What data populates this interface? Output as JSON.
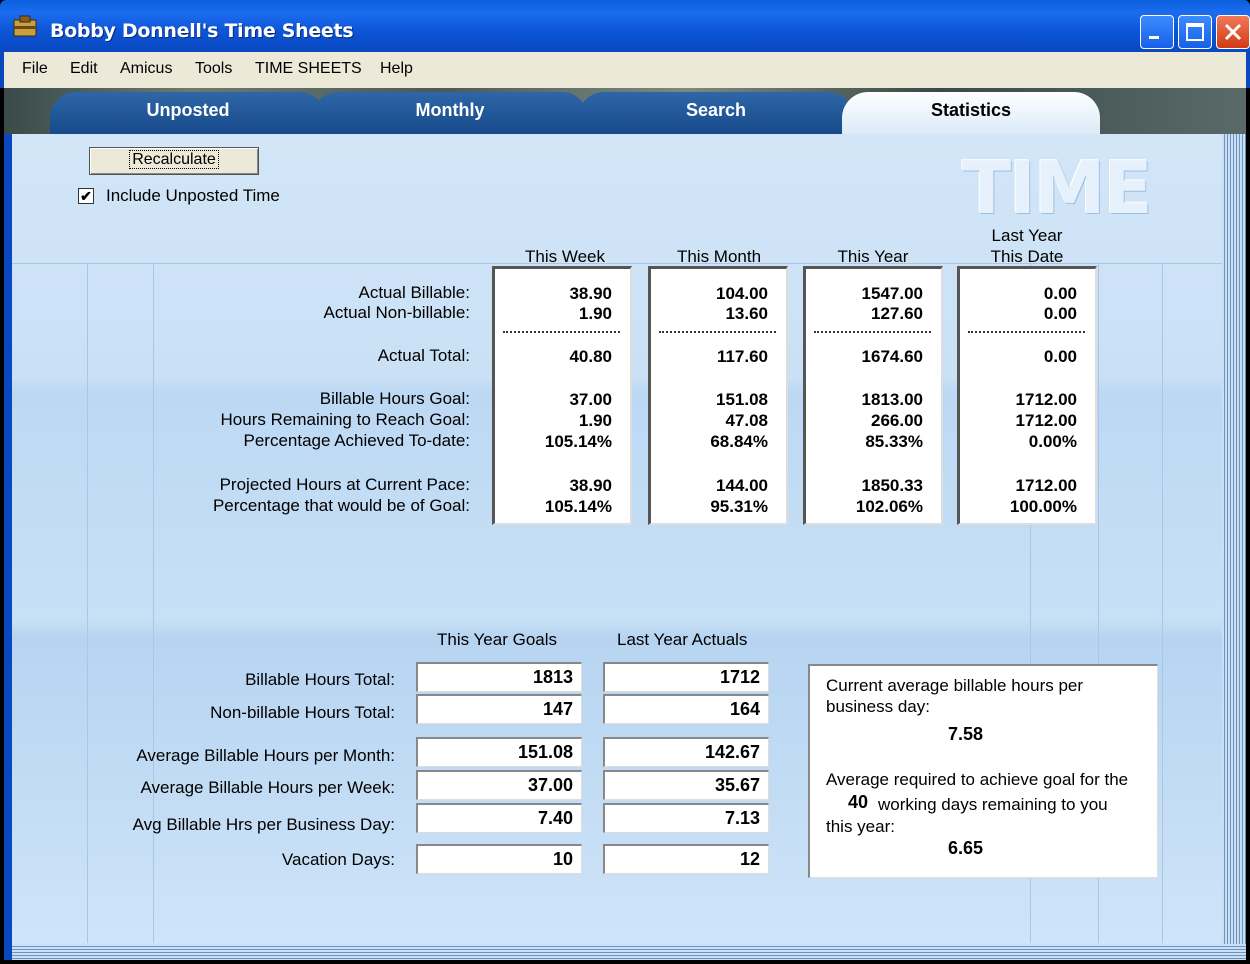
{
  "window": {
    "title": "Bobby Donnell's Time Sheets"
  },
  "menu": [
    "File",
    "Edit",
    "Amicus",
    "Tools",
    "TIME SHEETS",
    "Help"
  ],
  "tabs": [
    {
      "label": "Unposted",
      "active": false
    },
    {
      "label": "Monthly",
      "active": false
    },
    {
      "label": "Search",
      "active": false
    },
    {
      "label": "Statistics",
      "active": true
    }
  ],
  "logo_text": "TIME",
  "recalculate_label": "Recalculate",
  "include_unposted": {
    "label": "Include Unposted Time",
    "checked": true
  },
  "stats": {
    "columns": [
      "This Week",
      "This Month",
      "This Year",
      "Last Year This Date"
    ],
    "column_last_line1": "Last Year",
    "column_last_line2": "This Date",
    "row_labels": {
      "actual_billable": "Actual Billable:",
      "actual_nonbillable": "Actual Non-billable:",
      "actual_total": "Actual Total:",
      "goal": "Billable Hours Goal:",
      "remaining": "Hours Remaining to Reach Goal:",
      "pct_achieved": "Percentage Achieved To-date:",
      "projected": "Projected Hours at Current Pace:",
      "pct_goal": "Percentage that would be of Goal:"
    },
    "values": [
      [
        "38.90",
        "1.90",
        "40.80",
        "37.00",
        "1.90",
        "105.14%",
        "38.90",
        "105.14%"
      ],
      [
        "104.00",
        "13.60",
        "117.60",
        "151.08",
        "47.08",
        "68.84%",
        "144.00",
        "95.31%"
      ],
      [
        "1547.00",
        "127.60",
        "1674.60",
        "1813.00",
        "266.00",
        "85.33%",
        "1850.33",
        "102.06%"
      ],
      [
        "0.00",
        "0.00",
        "0.00",
        "1712.00",
        "1712.00",
        "0.00%",
        "1712.00",
        "100.00%"
      ]
    ]
  },
  "goals": {
    "headers": [
      "This Year Goals",
      "Last Year Actuals"
    ],
    "rows": [
      {
        "label": "Billable Hours Total:",
        "goal": "1813",
        "actual": "1712"
      },
      {
        "label": "Non-billable Hours Total:",
        "goal": "147",
        "actual": "164"
      },
      {
        "label": "Average Billable Hours per Month:",
        "goal": "151.08",
        "actual": "142.67"
      },
      {
        "label": "Average Billable Hours per Week:",
        "goal": "37.00",
        "actual": "35.67"
      },
      {
        "label": "Avg Billable Hrs per Business Day:",
        "goal": "7.40",
        "actual": "7.13"
      },
      {
        "label": "Vacation Days:",
        "goal": "10",
        "actual": "12"
      }
    ]
  },
  "info": {
    "line1": "Current average billable hours per",
    "line2": "business day:",
    "current_avg": "7.58",
    "line3": "Average required to achieve goal for the",
    "working_days": "40",
    "line4": "working days remaining to you",
    "line5": "this year:",
    "required_avg": "6.65"
  },
  "colors": {
    "titlebar": "#0a55d6",
    "panel": "#c9e0f5",
    "tab_active": "#ffffff",
    "tab_inactive": "#174a8a",
    "close_button": "#d13a12"
  }
}
